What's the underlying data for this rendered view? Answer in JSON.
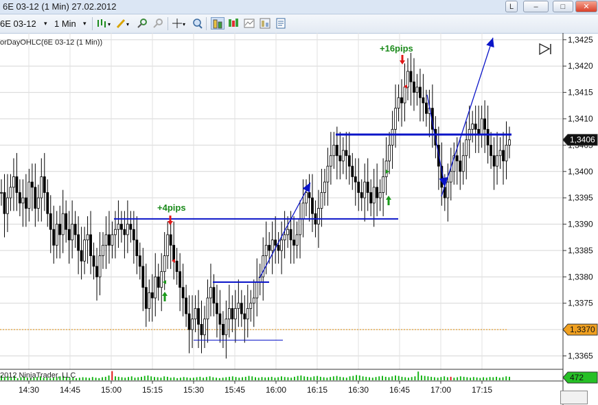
{
  "window": {
    "title": "6E 03-12 (1 Min)  27.02.2012",
    "buttons": {
      "pin": "L",
      "minimize": "–",
      "maximize": "□",
      "close": "✕"
    }
  },
  "toolbar": {
    "instrument": "6E 03-12",
    "interval": "1 Min",
    "dropdown_glyph": "▾",
    "icons": [
      "bar-type-icon",
      "pencil-draw-icon",
      "zoom-in-icon",
      "zoom-out-icon",
      "crosshair-icon",
      "magnifier-icon",
      "chart-trader-icon",
      "data-box-icon",
      "properties-icon",
      "template-icon"
    ]
  },
  "indicator_label": "orDayOHLC(6E 03-12 (1 Min))",
  "copyright": "2012 NinjaTrader, LLC",
  "colors": {
    "up": "#000000",
    "down": "#000000",
    "trendline": "#0a14c8",
    "prior_day_line": "#e08a00",
    "volume_up": "#18b418",
    "volume_down": "#e01818",
    "price_marker": "#ffffff",
    "prior_marker": "#f0a020",
    "volume_marker": "#26c026"
  },
  "annotations": {
    "pips_small": "+4pips",
    "pips_large": "+16pips"
  },
  "chart_data": {
    "type": "candlestick",
    "instrument": "6E 03-12",
    "interval": "1 Min",
    "y_ticks": [
      "1,3365",
      "1,3370",
      "1,3375",
      "1,3380",
      "1,3385",
      "1,3390",
      "1,3395",
      "1,3400",
      "1,3405",
      "1,3410",
      "1,3415",
      "1,3420",
      "1,3425"
    ],
    "x_ticks": [
      "14:30",
      "14:45",
      "15:00",
      "15:15",
      "15:30",
      "15:45",
      "16:00",
      "16:15",
      "16:30",
      "16:45",
      "17:00",
      "17:15"
    ],
    "ylim": [
      1.33635,
      1.34255
    ],
    "xlim": [
      "14:18",
      "17:28"
    ],
    "last_price": "1,3406",
    "prior_level": "1,3370",
    "last_volume": "472",
    "close_series": [
      1.3396,
      1.3392,
      1.3395,
      1.3397,
      1.3399,
      1.3396,
      1.3394,
      1.3395,
      1.3393,
      1.3398,
      1.3397,
      1.3393,
      1.3395,
      1.3399,
      1.3396,
      1.3392,
      1.3389,
      1.3386,
      1.339,
      1.3388,
      1.3392,
      1.3389,
      1.3387,
      1.339,
      1.3388,
      1.3385,
      1.3383,
      1.3387,
      1.3388,
      1.3384,
      1.3382,
      1.338,
      1.3384,
      1.3386,
      1.3388,
      1.3386,
      1.3388,
      1.3389,
      1.339,
      1.3389,
      1.3388,
      1.339,
      1.3389,
      1.3387,
      1.3384,
      1.3382,
      1.3378,
      1.3374,
      1.3377,
      1.3376,
      1.338,
      1.3378,
      1.3381,
      1.3384,
      1.3388,
      1.3386,
      1.3383,
      1.3381,
      1.3378,
      1.3376,
      1.3373,
      1.337,
      1.3372,
      1.3374,
      1.3371,
      1.3369,
      1.3372,
      1.3376,
      1.3378,
      1.3375,
      1.3373,
      1.3371,
      1.3369,
      1.3372,
      1.3374,
      1.3372,
      1.3374,
      1.3375,
      1.3373,
      1.3372,
      1.3374,
      1.3375,
      1.3376,
      1.3379,
      1.338,
      1.3384,
      1.3386,
      1.3385,
      1.3387,
      1.3386,
      1.3385,
      1.3387,
      1.3388,
      1.3389,
      1.3387,
      1.3386,
      1.3388,
      1.3391,
      1.3394,
      1.3396,
      1.3395,
      1.3392,
      1.339,
      1.3393,
      1.3396,
      1.3398,
      1.3401,
      1.3403,
      1.3405,
      1.3403,
      1.3402,
      1.3404,
      1.3403,
      1.3401,
      1.3399,
      1.3398,
      1.3396,
      1.3395,
      1.3398,
      1.3396,
      1.3394,
      1.3397,
      1.3395,
      1.3396,
      1.3399,
      1.3402,
      1.3405,
      1.3408,
      1.3412,
      1.3414,
      1.3413,
      1.3416,
      1.3419,
      1.3417,
      1.3415,
      1.3416,
      1.3414,
      1.3413,
      1.3411,
      1.3412,
      1.3408,
      1.3405,
      1.3401,
      1.3397,
      1.3395,
      1.3398,
      1.34,
      1.3403,
      1.3402,
      1.34,
      1.3403,
      1.3406,
      1.3408,
      1.3409,
      1.3408,
      1.3407,
      1.341,
      1.3408,
      1.3405,
      1.3403,
      1.3401,
      1.3403,
      1.3404,
      1.3402,
      1.3405,
      1.3406
    ],
    "volume_series": [
      22,
      15,
      18,
      12,
      20,
      10,
      14,
      16,
      12,
      11,
      13,
      15,
      18,
      12,
      14,
      10,
      12,
      15,
      18,
      20,
      16,
      12,
      14,
      10,
      12,
      14,
      13,
      11,
      15,
      12,
      10,
      14,
      16,
      22,
      42,
      18,
      16,
      14,
      12,
      15,
      18,
      12,
      14,
      16,
      20,
      22,
      18,
      15,
      14,
      12,
      18,
      16,
      12,
      14,
      10,
      12,
      15,
      13,
      11,
      12,
      14,
      16,
      12,
      15,
      18,
      14,
      12,
      10,
      12,
      14,
      16,
      18,
      15,
      12,
      14,
      16,
      20,
      18,
      14,
      12,
      15,
      13,
      14,
      16,
      12,
      14,
      18,
      15,
      14,
      12,
      16,
      20,
      22,
      18,
      16,
      14,
      18,
      20,
      16,
      14,
      12,
      15,
      18,
      20,
      16,
      14,
      12,
      18,
      20,
      24,
      22,
      18,
      16,
      14,
      12,
      15,
      18,
      20,
      16,
      14,
      18,
      22,
      20,
      16,
      14,
      12,
      15,
      18,
      40,
      22,
      20,
      18,
      16,
      14,
      12,
      15,
      18,
      14,
      16,
      12,
      14,
      18,
      16,
      14,
      12,
      15,
      13,
      11,
      14,
      12,
      15,
      14,
      16,
      12,
      14,
      18,
      16
    ],
    "volume_down_idx": [
      34,
      138
    ],
    "lines": [
      {
        "kind": "level",
        "price": 1.3391
      },
      {
        "kind": "level",
        "price": 1.3379
      },
      {
        "kind": "level",
        "price": 1.3368
      },
      {
        "kind": "level",
        "price": 1.3407
      },
      {
        "kind": "trend-up"
      },
      {
        "kind": "trend-down"
      },
      {
        "kind": "trend-up"
      }
    ]
  }
}
